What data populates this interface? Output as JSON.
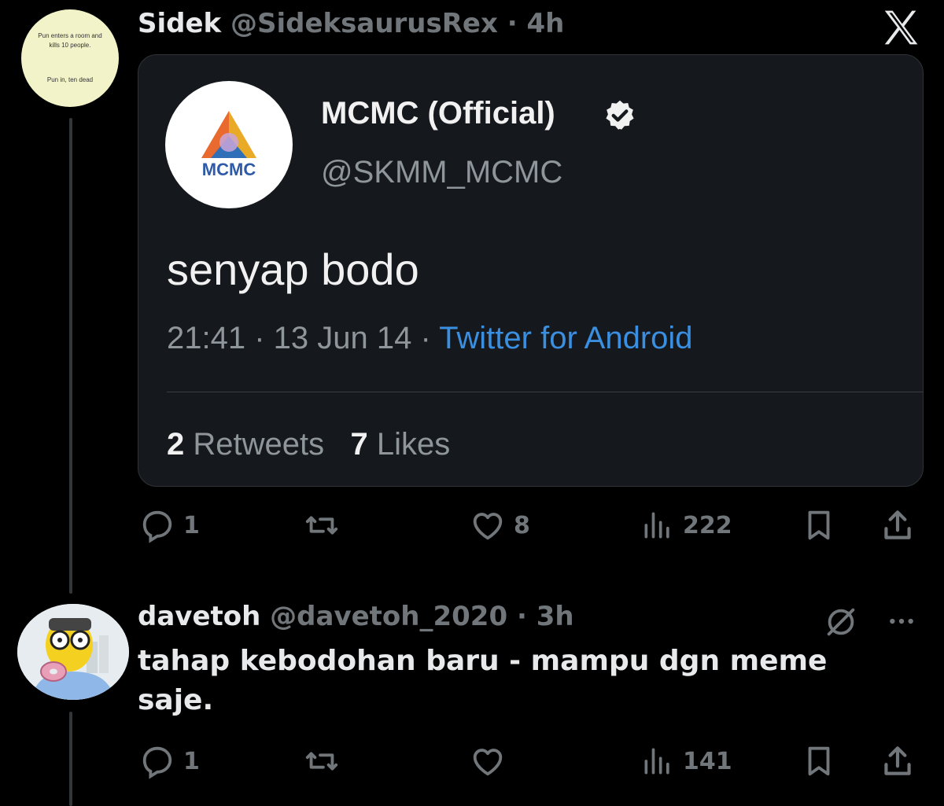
{
  "tweet1": {
    "display_name": "Sidek",
    "handle": "@SideksaurusRex",
    "time": "· 4h",
    "avatar_text": [
      "Pun enters a room and",
      "kills 10 people.",
      "Pun in, ten dead"
    ],
    "quoted_screenshot": {
      "name": "MCMC (Official)",
      "handle": "@SKMM_MCMC",
      "logo_text": "MCMC",
      "text": "senyap bodo",
      "timestamp": "21:41 · 13 Jun 14 · ",
      "source": "Twitter for Android",
      "retweets_count": "2",
      "retweets_label": " Retweets",
      "likes_count": "7",
      "likes_label": " Likes"
    },
    "actions": {
      "replies": "1",
      "likes": "8",
      "views": "222"
    }
  },
  "tweet2": {
    "display_name": "davetoh",
    "handle": "@davetoh_2020",
    "time": "· 3h",
    "text": "tahap kebodohan baru - mampu dgn meme saje.",
    "actions": {
      "replies": "1",
      "views": "141"
    }
  },
  "colors": {
    "background": "#000000",
    "text": "#e7e9ea",
    "muted": "#71767b",
    "link": "#3b8fe0",
    "card": "#15181c"
  },
  "icons": [
    "x-logo-icon",
    "verified-badge-icon",
    "reply-icon",
    "retweet-icon",
    "like-icon",
    "views-icon",
    "bookmark-icon",
    "share-icon",
    "grok-icon",
    "more-icon"
  ]
}
